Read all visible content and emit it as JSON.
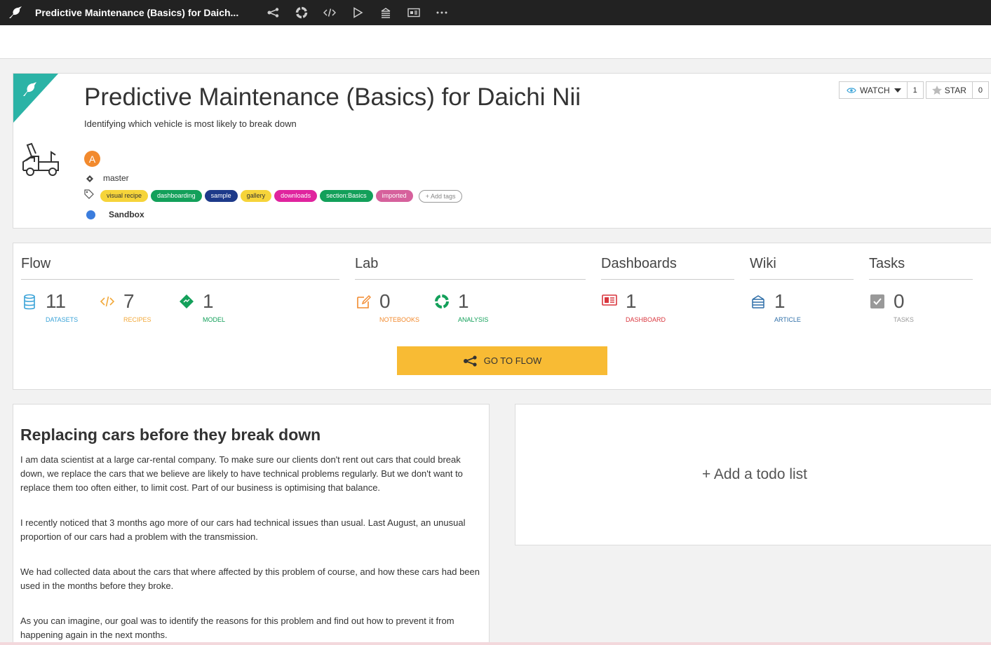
{
  "topbar": {
    "title": "Predictive Maintenance (Basics) for Daich...",
    "icons": [
      "bird-logo-icon",
      "flow-icon",
      "analysis-ring-icon",
      "code-icon",
      "run-icon",
      "wiki-icon",
      "dashboard-icon",
      "more-icon"
    ]
  },
  "project": {
    "title": "Predictive Maintenance (Basics) for Daichi Nii",
    "description": "Identifying which vehicle is most likely to break down",
    "avatar_letter": "A",
    "branch": "master",
    "tags": [
      {
        "label": "visual recipe",
        "color": "#f6d43a",
        "text_color": "#333"
      },
      {
        "label": "dashboarding",
        "color": "#13a05a",
        "text_color": "#fff"
      },
      {
        "label": "sample",
        "color": "#1d3a8a",
        "text_color": "#fff"
      },
      {
        "label": "gallery",
        "color": "#f6d43a",
        "text_color": "#333"
      },
      {
        "label": "downloads",
        "color": "#e0249e",
        "text_color": "#fff"
      },
      {
        "label": "section:Basics",
        "color": "#13a05a",
        "text_color": "#fff"
      },
      {
        "label": "imported",
        "color": "#d6619c",
        "text_color": "#fff"
      }
    ],
    "add_tags_label": "+ Add tags",
    "status": "Sandbox",
    "watch": {
      "label": "WATCH",
      "count": "1"
    },
    "star": {
      "label": "STAR",
      "count": "0"
    }
  },
  "stats": {
    "sections": {
      "flow": "Flow",
      "lab": "Lab",
      "dashboards": "Dashboards",
      "wiki": "Wiki",
      "tasks": "Tasks"
    },
    "items": {
      "datasets": {
        "value": "11",
        "label": "DATASETS",
        "color": "#3aa3d8"
      },
      "recipes": {
        "value": "7",
        "label": "RECIPES",
        "color": "#f2a93b"
      },
      "model": {
        "value": "1",
        "label": "MODEL",
        "color": "#13a05a"
      },
      "notebooks": {
        "value": "0",
        "label": "NOTEBOOKS",
        "color": "#f28a2e"
      },
      "analysis": {
        "value": "1",
        "label": "ANALYSIS",
        "color": "#13a05a"
      },
      "dashboard": {
        "value": "1",
        "label": "DASHBOARD",
        "color": "#d9363e"
      },
      "article": {
        "value": "1",
        "label": "ARTICLE",
        "color": "#2f6fa8"
      },
      "tasks": {
        "value": "0",
        "label": "TASKS",
        "color": "#999999"
      }
    },
    "go_to_flow": "GO TO FLOW"
  },
  "description": {
    "heading": "Replacing cars before they break down",
    "paragraphs": [
      "I am data scientist at a large car-rental company. To make sure our clients don't rent out cars that could break down, we replace the cars that we believe are likely to have technical problems regularly. But we don't want to replace them too often either, to limit cost. Part of our business is optimising that balance.",
      "I recently noticed that 3 months ago more of our cars had technical issues than usual. Last August, an unusual proportion of our cars had a problem with the transmission.",
      "We had collected data about the cars that where affected by this problem of course, and how these cars had been used in the months before they broke.",
      "As you can imagine, our goal was to identify the reasons for this problem and find out how to prevent it from happening again in the next months."
    ]
  },
  "todo": {
    "add_label": "+ Add a todo list"
  }
}
